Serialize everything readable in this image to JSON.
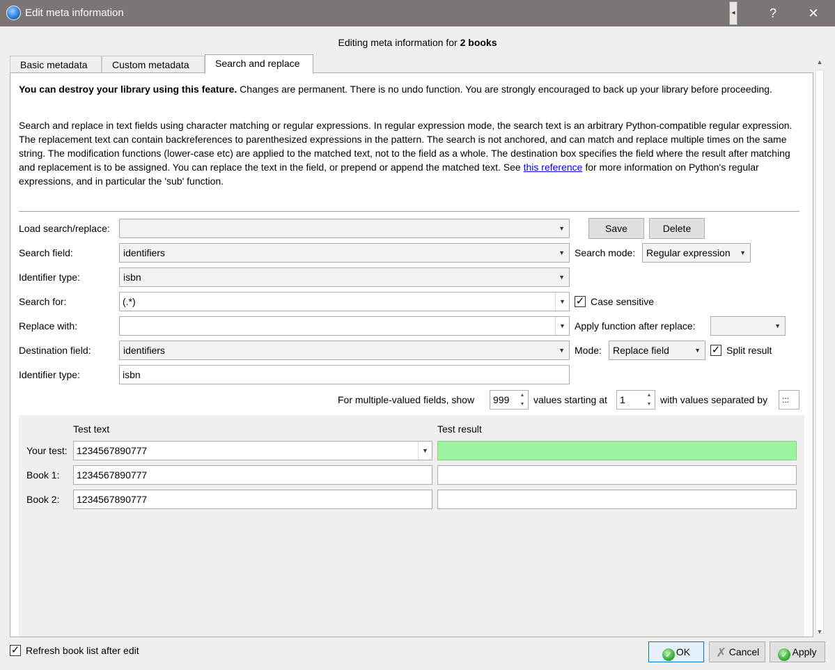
{
  "window": {
    "title": "Edit meta information",
    "help": "?",
    "close": "✕"
  },
  "header": {
    "prefix": "Editing meta information for ",
    "count": "2 books"
  },
  "tabs": [
    {
      "label": "Basic metadata"
    },
    {
      "label": "Custom metadata"
    },
    {
      "label": "Search and replace"
    }
  ],
  "warning": {
    "bold": "You can destroy your library using this feature.",
    "rest": " Changes are permanent. There is no undo function. You are strongly encouraged to back up your library before proceeding."
  },
  "description": {
    "text": "Search and replace in text fields using character matching or regular expressions. In regular expression mode, the search text is an arbitrary Python-compatible regular expression. The replacement text can contain backreferences to parenthesized expressions in the pattern. The search is not anchored, and can match and replace multiple times on the same string. The modification functions (lower-case etc) are applied to the matched text, not to the field as a whole. The destination box specifies the field where the result after matching and replacement is to be assigned. You can replace the text in the field, or prepend or append the matched text. See ",
    "link": "this reference",
    "after": " for more information on Python's regular expressions, and in particular the 'sub' function."
  },
  "form": {
    "load_label": "Load search/replace:",
    "load_value": "",
    "save_btn": "Save",
    "delete_btn": "Delete",
    "search_field_label": "Search field:",
    "search_field_value": "identifiers",
    "search_mode_label": "Search mode:",
    "search_mode_value": "Regular expression",
    "identifier_type_label": "Identifier type:",
    "identifier_type_value": "isbn",
    "search_for_label": "Search for:",
    "search_for_value": "(.*)",
    "case_sensitive_label": "Case sensitive",
    "case_sensitive_checked": true,
    "replace_with_label": "Replace with:",
    "replace_with_value": "",
    "apply_function_label": "Apply function after replace:",
    "apply_function_value": "",
    "destination_label": "Destination field:",
    "destination_value": "identifiers",
    "mode_label": "Mode:",
    "mode_value": "Replace field",
    "split_result_label": "Split result",
    "split_result_checked": true,
    "dest_identifier_label": "Identifier type:",
    "dest_identifier_value": "isbn",
    "multi_label_1": "For multiple-valued fields, show",
    "multi_show_value": "999",
    "multi_label_2": "values starting at",
    "multi_start_value": "1",
    "multi_label_3": "with values separated by",
    "multi_sep_value": ":::"
  },
  "test": {
    "col_text": "Test text",
    "col_result": "Test result",
    "your_test_label": "Your test:",
    "your_test_value": "1234567890777",
    "your_test_result": "",
    "book1_label": "Book 1:",
    "book1_value": "1234567890777",
    "book1_result": "",
    "book2_label": "Book 2:",
    "book2_value": "1234567890777",
    "book2_result": "",
    "result_color": "#9ef49e"
  },
  "footer": {
    "refresh_label": "Refresh book list after edit",
    "refresh_checked": true,
    "ok": "OK",
    "cancel": "Cancel",
    "apply": "Apply"
  }
}
